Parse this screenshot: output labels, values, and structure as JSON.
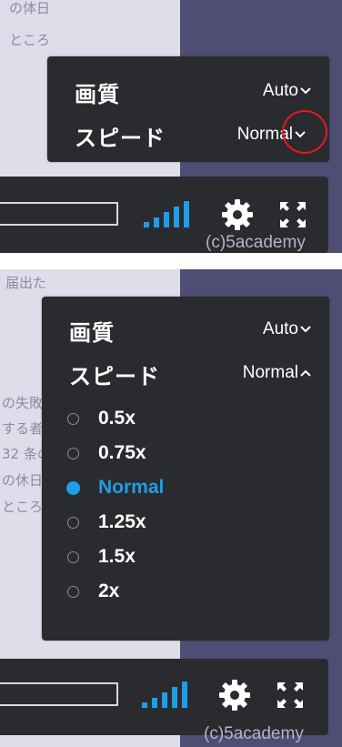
{
  "watermark": "(c)5academy",
  "top_panel": {
    "bg_texts": [
      "の体日",
      "ところ"
    ],
    "quality": {
      "label": "画質",
      "value": "Auto"
    },
    "speed": {
      "label": "スピード",
      "value": "Normal"
    }
  },
  "bottom_panel": {
    "bg_texts": [
      "届出た",
      "の失敗",
      "する者",
      "32 条の",
      "の休日",
      "ところ"
    ],
    "quality": {
      "label": "画質",
      "value": "Auto"
    },
    "speed": {
      "label": "スピード",
      "value": "Normal"
    },
    "options": [
      "0.5x",
      "0.75x",
      "Normal",
      "1.25x",
      "1.5x",
      "2x"
    ],
    "selected_option": "Normal"
  },
  "colors": {
    "accent": "#1e9ee6",
    "menu_bg": "#2a2b2f",
    "circle": "#e8191d"
  }
}
